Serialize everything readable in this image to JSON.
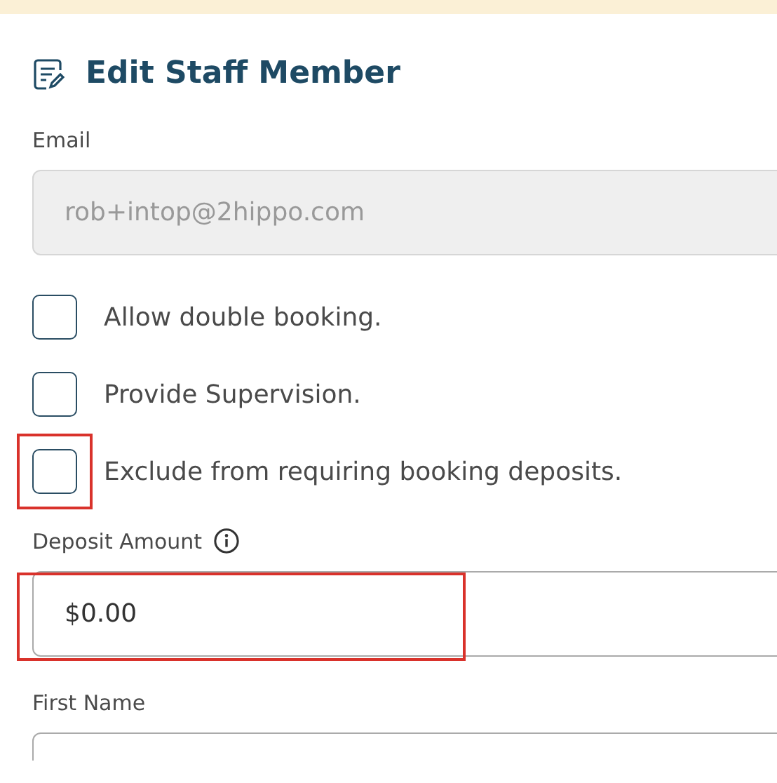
{
  "title": "Edit Staff Member",
  "email": {
    "label": "Email",
    "value": "rob+intop@2hippo.com",
    "disabled": true
  },
  "options": [
    {
      "label": "Allow double booking.",
      "checked": false,
      "highlighted": false
    },
    {
      "label": "Provide Supervision.",
      "checked": false,
      "highlighted": false
    },
    {
      "label": "Exclude from requiring booking deposits.",
      "checked": false,
      "highlighted": true
    }
  ],
  "deposit": {
    "label": "Deposit Amount",
    "value": "$0.00",
    "highlighted": true
  },
  "first_name": {
    "label": "First Name"
  }
}
